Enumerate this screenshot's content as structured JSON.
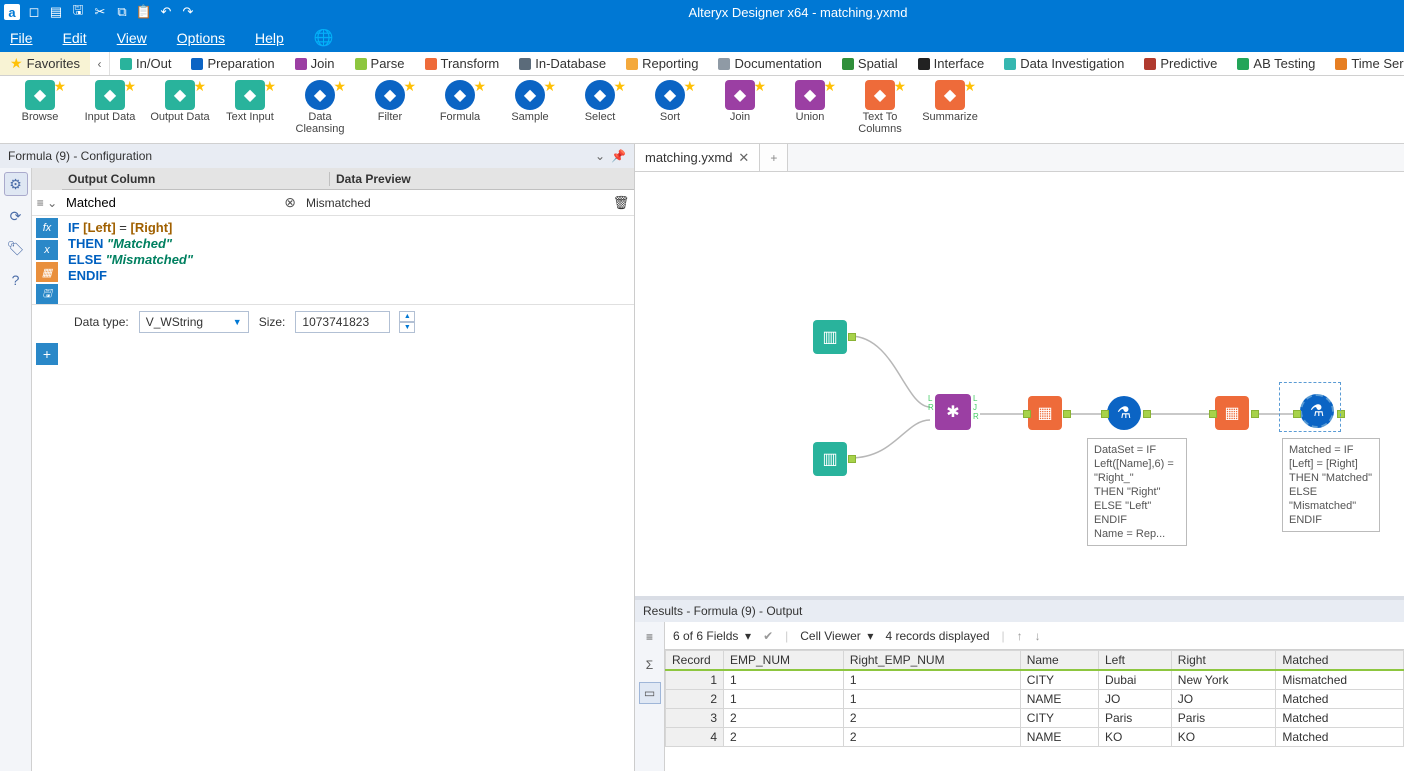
{
  "app": {
    "title": "Alteryx Designer x64 - matching.yxmd",
    "document": "matching.yxmd"
  },
  "menu": [
    "File",
    "Edit",
    "View",
    "Options",
    "Help"
  ],
  "categories": [
    {
      "label": "Favorites",
      "active": true,
      "icon": "star",
      "color": ""
    },
    {
      "label": "In/Out",
      "color": "#29b39c"
    },
    {
      "label": "Preparation",
      "color": "#0b64c4"
    },
    {
      "label": "Join",
      "color": "#9b3fa3"
    },
    {
      "label": "Parse",
      "color": "#8dc63f"
    },
    {
      "label": "Transform",
      "color": "#ee6b3a"
    },
    {
      "label": "In-Database",
      "color": "#5b6b7a"
    },
    {
      "label": "Reporting",
      "color": "#f4a93c"
    },
    {
      "label": "Documentation",
      "color": "#8f9aa5"
    },
    {
      "label": "Spatial",
      "color": "#2f8f3a"
    },
    {
      "label": "Interface",
      "color": "#222"
    },
    {
      "label": "Data Investigation",
      "color": "#35b7b0"
    },
    {
      "label": "Predictive",
      "color": "#b03a2e"
    },
    {
      "label": "AB Testing",
      "color": "#23a559"
    },
    {
      "label": "Time Series",
      "color": "#e67e22"
    }
  ],
  "tools": [
    {
      "label": "Browse",
      "cls": "input"
    },
    {
      "label": "Input Data",
      "cls": "input"
    },
    {
      "label": "Output Data",
      "cls": "input"
    },
    {
      "label": "Text Input",
      "cls": "input"
    },
    {
      "label": "Data Cleansing",
      "cls": "formula"
    },
    {
      "label": "Filter",
      "cls": "formula"
    },
    {
      "label": "Formula",
      "cls": "formula"
    },
    {
      "label": "Sample",
      "cls": "formula"
    },
    {
      "label": "Select",
      "cls": "formula"
    },
    {
      "label": "Sort",
      "cls": "formula"
    },
    {
      "label": "Join",
      "cls": "join"
    },
    {
      "label": "Union",
      "cls": "join"
    },
    {
      "label": "Text To Columns",
      "cls": "trans"
    },
    {
      "label": "Summarize",
      "cls": "trans"
    }
  ],
  "config": {
    "title": "Formula (9) - Configuration",
    "col_output": "Output Column",
    "col_preview": "Data Preview",
    "output_value": "Matched",
    "preview_value": "Mismatched",
    "datatype_label": "Data type:",
    "datatype_value": "V_WString",
    "size_label": "Size:",
    "size_value": "1073741823"
  },
  "formula": {
    "l1a": "IF ",
    "l1b": "[Left]",
    "l1c": " = ",
    "l1d": "[Right]",
    "l2a": "THEN ",
    "l2b": "\"Matched\"",
    "l3a": "ELSE ",
    "l3b": "\"Mismatched\"",
    "l4": "ENDIF"
  },
  "canvas": {
    "ann1": "DataSet = IF Left([Name],6) = \"Right_\"\nTHEN \"Right\"\nELSE \"Left\"\nENDIF\nName = Rep...",
    "ann2": "Matched = IF [Left] = [Right] THEN \"Matched\" ELSE \"Mismatched\" ENDIF"
  },
  "results": {
    "title": "Results - Formula (9) - Output",
    "fields": "6 of 6 Fields",
    "viewer": "Cell Viewer",
    "count": "4 records displayed",
    "headers": [
      "Record",
      "EMP_NUM",
      "Right_EMP_NUM",
      "Name",
      "Left",
      "Right",
      "Matched"
    ],
    "rows": [
      [
        "1",
        "1",
        "1",
        "CITY",
        "Dubai",
        "New York",
        "Mismatched"
      ],
      [
        "2",
        "1",
        "1",
        "NAME",
        "JO",
        "JO",
        "Matched"
      ],
      [
        "3",
        "2",
        "2",
        "CITY",
        "Paris",
        "Paris",
        "Matched"
      ],
      [
        "4",
        "2",
        "2",
        "NAME",
        "KO",
        "KO",
        "Matched"
      ]
    ]
  }
}
